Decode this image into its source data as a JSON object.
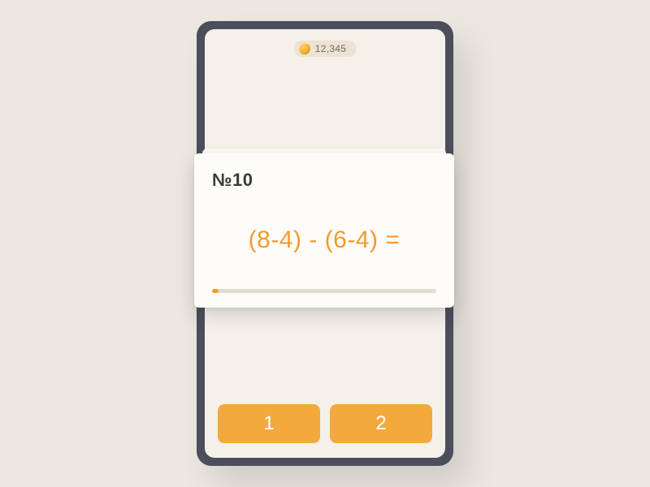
{
  "header": {
    "coin_amount": "12,345"
  },
  "card": {
    "number_label": "№10",
    "expression": "(8-4) - (6-4) =",
    "progress_percent": 3
  },
  "answers": {
    "option1": "1",
    "option2": "2"
  }
}
